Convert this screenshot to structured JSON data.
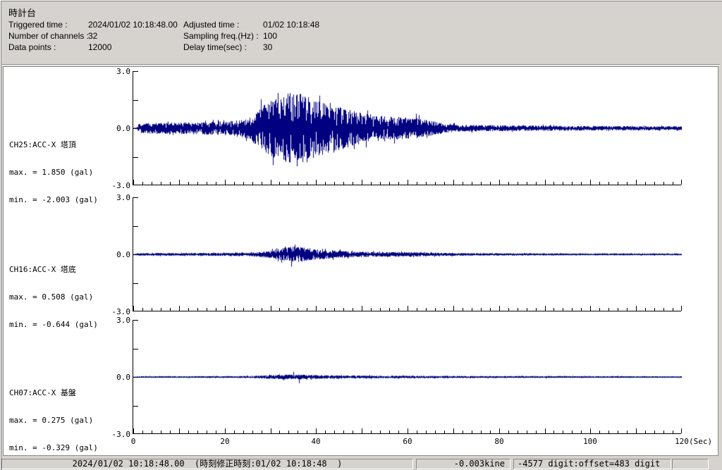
{
  "header": {
    "title": "時計台",
    "fields": [
      {
        "label": "Triggered time :",
        "value": "2024/01/02 10:18:48.00"
      },
      {
        "label": "Adjusted time :",
        "value": "01/02 10:18:48"
      },
      {
        "label": "Number of channels : ",
        "value": "32"
      },
      {
        "label": "Sampling freq.(Hz) : ",
        "value": "100"
      },
      {
        "label": "Data points :",
        "value": "12000"
      },
      {
        "label": "Delay time(sec) : ",
        "value": "30"
      }
    ]
  },
  "status_bar": {
    "time_text": "2024/01/02 10:18:48.00  (時刻修正時刻:01/02 10:18:48  )",
    "kine_text": "-0.003kine",
    "digit_text": "-4577 digit:offset=483 digit",
    "spare_text": ""
  },
  "colors": {
    "waveform": "#000080",
    "baseline": "#008000",
    "axis": "#000000",
    "panel": "#d6d3ce",
    "plot_bg": "#ffffff"
  },
  "chart_data": [
    {
      "type": "line",
      "channel": "CH25:ACC-X 塔頂",
      "max_label": "max. = 1.850 (gal)",
      "min_label": "min. = -2.003 (gal)",
      "max_gal": 1.85,
      "min_gal": -2.003,
      "ylabel_unit": "gal",
      "ylim": [
        -3.0,
        3.0
      ],
      "y_tick_labels": [
        {
          "v": 3.0,
          "label": "3.0"
        },
        {
          "v": 1.5,
          "label": ""
        },
        {
          "v": 0.0,
          "label": "0.0"
        },
        {
          "v": -1.5,
          "label": ""
        },
        {
          "v": -3.0,
          "label": "-3.0"
        }
      ],
      "x_range": [
        0,
        120
      ],
      "x_major_ticks": [
        0,
        20,
        40,
        60,
        80,
        100,
        120
      ],
      "x_minor_step": 2,
      "x_unit": "(Sec)",
      "show_x_labels": false,
      "grid": false,
      "seed": 101,
      "envelope": [
        [
          0,
          0.02
        ],
        [
          0.8,
          0.06
        ],
        [
          1.2,
          0.28
        ],
        [
          8,
          0.3
        ],
        [
          15,
          0.32
        ],
        [
          22,
          0.4
        ],
        [
          25,
          0.55
        ],
        [
          28,
          1.1
        ],
        [
          30,
          1.5
        ],
        [
          33,
          1.8
        ],
        [
          36,
          1.9
        ],
        [
          39,
          1.55
        ],
        [
          43,
          1.35
        ],
        [
          47,
          1.0
        ],
        [
          50,
          0.8
        ],
        [
          54,
          0.65
        ],
        [
          58,
          0.6
        ],
        [
          62,
          0.55
        ],
        [
          65,
          0.4
        ],
        [
          68,
          0.25
        ],
        [
          72,
          0.18
        ],
        [
          80,
          0.15
        ],
        [
          90,
          0.14
        ],
        [
          100,
          0.12
        ],
        [
          110,
          0.11
        ],
        [
          120,
          0.1
        ]
      ],
      "peaks": [
        {
          "t": 34.2,
          "v": 1.85
        },
        {
          "t": 35.8,
          "v": -2.003
        }
      ]
    },
    {
      "type": "line",
      "channel": "CH16:ACC-X 塔底",
      "max_label": "max. = 0.508 (gal)",
      "min_label": "min. = -0.644 (gal)",
      "max_gal": 0.508,
      "min_gal": -0.644,
      "ylabel_unit": "gal",
      "ylim": [
        -3.0,
        3.0
      ],
      "y_tick_labels": [
        {
          "v": 3.0,
          "label": "3.0"
        },
        {
          "v": 1.5,
          "label": ""
        },
        {
          "v": 0.0,
          "label": "0.0"
        },
        {
          "v": -1.5,
          "label": ""
        },
        {
          "v": -3.0,
          "label": "-3.0"
        }
      ],
      "x_range": [
        0,
        120
      ],
      "x_major_ticks": [
        0,
        20,
        40,
        60,
        80,
        100,
        120
      ],
      "x_minor_step": 2,
      "x_unit": "(Sec)",
      "show_x_labels": false,
      "grid": false,
      "seed": 202,
      "envelope": [
        [
          0,
          0.01
        ],
        [
          0.8,
          0.06
        ],
        [
          5,
          0.07
        ],
        [
          20,
          0.08
        ],
        [
          26,
          0.1
        ],
        [
          30,
          0.2
        ],
        [
          33,
          0.35
        ],
        [
          35,
          0.42
        ],
        [
          37,
          0.38
        ],
        [
          40,
          0.28
        ],
        [
          44,
          0.2
        ],
        [
          48,
          0.16
        ],
        [
          52,
          0.13
        ],
        [
          56,
          0.12
        ],
        [
          60,
          0.13
        ],
        [
          64,
          0.1
        ],
        [
          68,
          0.08
        ],
        [
          75,
          0.07
        ],
        [
          85,
          0.06
        ],
        [
          100,
          0.05
        ],
        [
          120,
          0.05
        ]
      ],
      "peaks": [
        {
          "t": 35.3,
          "v": 0.508
        },
        {
          "t": 34.6,
          "v": -0.644
        }
      ]
    },
    {
      "type": "line",
      "channel": "CH07:ACC-X 基盤",
      "max_label": "max. = 0.275 (gal)",
      "min_label": "min. = -0.329 (gal)",
      "max_gal": 0.275,
      "min_gal": -0.329,
      "ylabel_unit": "gal",
      "ylim": [
        -3.0,
        3.0
      ],
      "y_tick_labels": [
        {
          "v": 3.0,
          "label": "3.0"
        },
        {
          "v": 1.5,
          "label": ""
        },
        {
          "v": 0.0,
          "label": "0.0"
        },
        {
          "v": -1.5,
          "label": ""
        },
        {
          "v": -3.0,
          "label": "-3.0"
        }
      ],
      "x_range": [
        0,
        120
      ],
      "x_major_ticks": [
        0,
        20,
        40,
        60,
        80,
        100,
        120
      ],
      "x_minor_step": 2,
      "x_unit": "(Sec)",
      "show_x_labels": true,
      "grid": false,
      "seed": 303,
      "envelope": [
        [
          0,
          0.008
        ],
        [
          0.8,
          0.04
        ],
        [
          20,
          0.045
        ],
        [
          26,
          0.06
        ],
        [
          30,
          0.1
        ],
        [
          33,
          0.13
        ],
        [
          36,
          0.12
        ],
        [
          40,
          0.1
        ],
        [
          44,
          0.09
        ],
        [
          48,
          0.08
        ],
        [
          53,
          0.07
        ],
        [
          58,
          0.07
        ],
        [
          63,
          0.06
        ],
        [
          70,
          0.06
        ],
        [
          80,
          0.05
        ],
        [
          90,
          0.05
        ],
        [
          100,
          0.045
        ],
        [
          110,
          0.04
        ],
        [
          120,
          0.04
        ]
      ],
      "peaks": [
        {
          "t": 35.0,
          "v": 0.275
        },
        {
          "t": 36.2,
          "v": -0.329
        }
      ]
    }
  ]
}
